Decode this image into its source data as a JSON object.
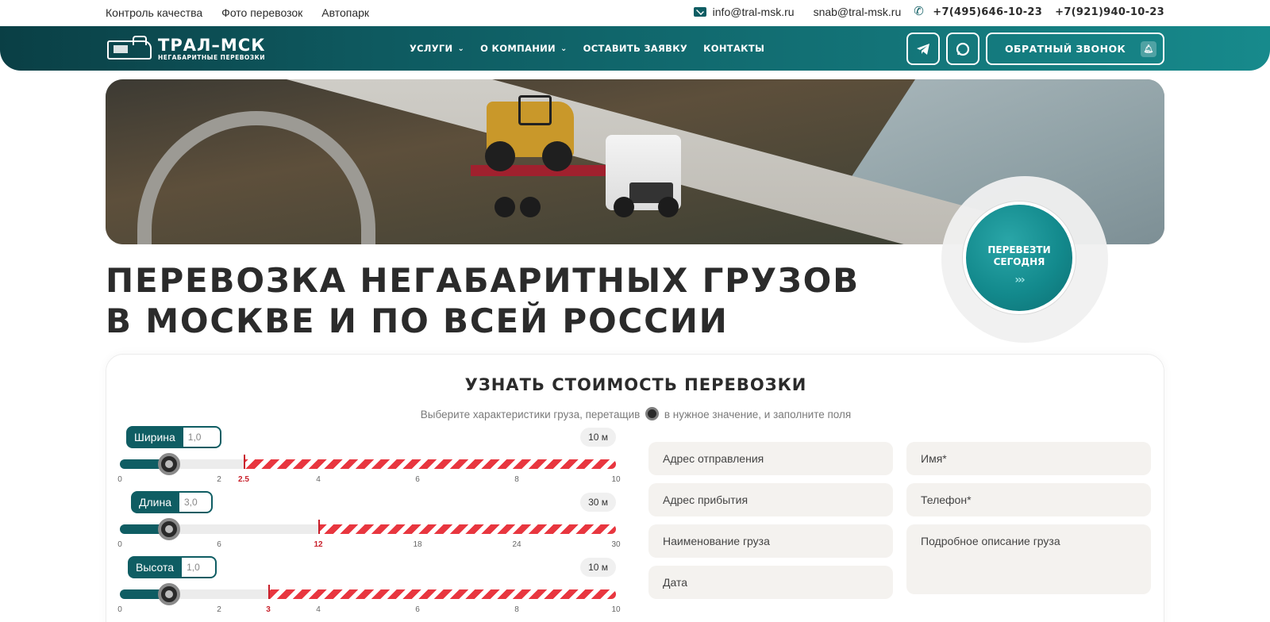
{
  "topnav": {
    "links": [
      "Контроль качества",
      "Фото перевозок",
      "Автопарк"
    ]
  },
  "contacts": {
    "emails": [
      "info@tral-msk.ru",
      "snab@tral-msk.ru"
    ],
    "phones": [
      "+7(495)646-10-23",
      "+7(921)940-10-23"
    ],
    "mail_icon": "mail-icon",
    "phone_icon": "phone-icon"
  },
  "header": {
    "logo_title": "ТРАЛ–МСК",
    "logo_sub": "НЕГАБАРИТНЫЕ ПЕРЕВОЗКИ",
    "nav": [
      "УСЛУГИ",
      "О КОМПАНИИ",
      "ОСТАВИТЬ ЗАЯВКУ",
      "КОНТАКТЫ"
    ],
    "callback_label": "ОБРАТНЫЙ ЗВОНОК",
    "telegram_icon": "telegram-icon",
    "whatsapp_icon": "whatsapp-icon",
    "bell_icon": "bell-icon",
    "accent_color": "#0f5d63"
  },
  "cta": {
    "line1": "ПЕРЕВЕЗТИ",
    "line2": "СЕГОДНЯ",
    "arrows": "›››"
  },
  "headline": {
    "line1": "ПЕРЕВОЗКА НЕГАБАРИТНЫХ ГРУЗОВ",
    "line2": "В МОСКВЕ И ПО ВСЕЙ РОССИИ"
  },
  "calc": {
    "title": "УЗНАТЬ СТОИМОСТЬ ПЕРЕВОЗКИ",
    "subtitle_before": "Выберите характеристики груза, перетащив",
    "subtitle_after": "в нужное значение, и заполните поля",
    "sliders": [
      {
        "label": "Ширина",
        "value": "1,0",
        "max_label": "10 м",
        "ticks": [
          "0",
          "2",
          "2.5",
          "4",
          "6",
          "8",
          "10"
        ],
        "limit_label": "2.5"
      },
      {
        "label": "Длина",
        "value": "3,0",
        "max_label": "30 м",
        "ticks": [
          "0",
          "6",
          "12",
          "18",
          "24",
          "30"
        ],
        "limit_label": "12"
      },
      {
        "label": "Высота",
        "value": "1,0",
        "max_label": "10 м",
        "ticks": [
          "0",
          "2",
          "3",
          "4",
          "6",
          "8",
          "10"
        ],
        "limit_label": "3"
      }
    ],
    "fields": {
      "from": "Адрес отправления",
      "to": "Адрес прибытия",
      "cargo": "Наименование груза",
      "date": "Дата",
      "name": "Имя*",
      "phone": "Телефон*",
      "description": "Подробное описание груза"
    },
    "stripe_color": "#e8363f"
  }
}
